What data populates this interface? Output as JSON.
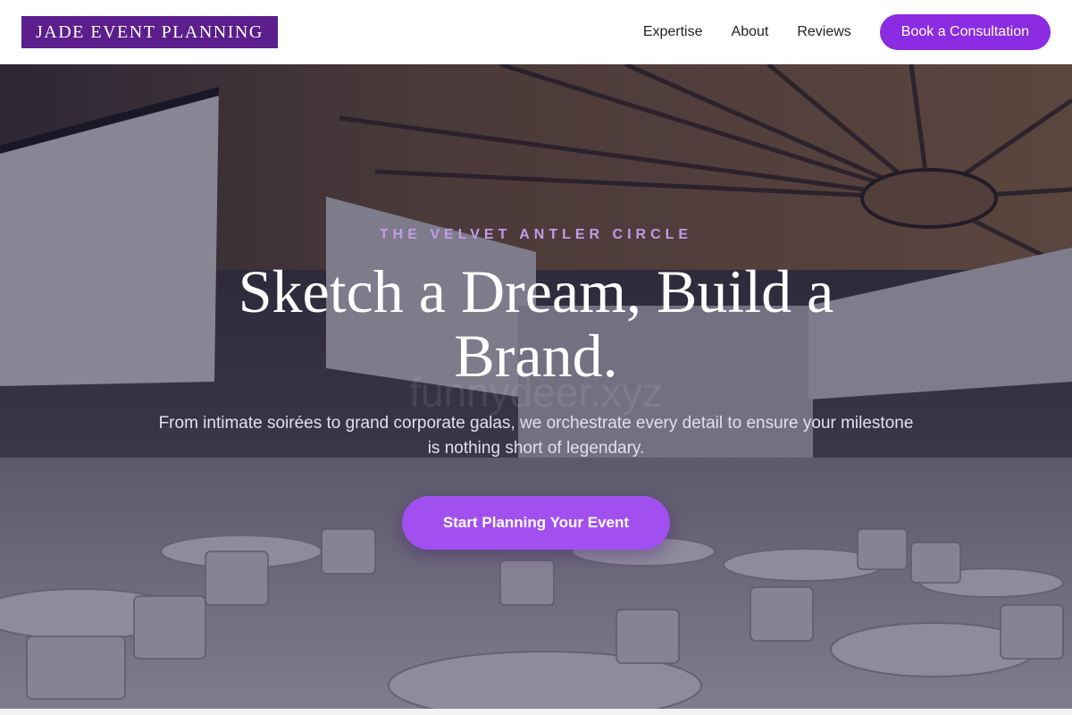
{
  "header": {
    "logo": "JADE EVENT PLANNING",
    "nav": [
      "Expertise",
      "About",
      "Reviews"
    ],
    "cta": "Book a Consultation"
  },
  "hero": {
    "eyebrow": "THE VELVET ANTLER CIRCLE",
    "headline": "Sketch a Dream, Build a Brand.",
    "watermark": "funnydeer.xyz",
    "subtext": "From intimate soirées to grand corporate galas, we orchestrate every detail to ensure your milestone is nothing short of legendary.",
    "cta": "Start Planning Your Event"
  },
  "colors": {
    "brand": "#5b1e8c",
    "accent": "#8b2be2",
    "cta_accent": "#a24ff0",
    "eyebrow": "#c39be8"
  }
}
